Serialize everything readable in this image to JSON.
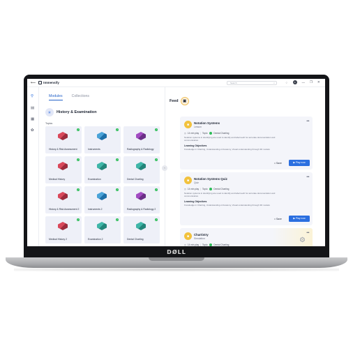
{
  "device": {
    "brand": "DØLL"
  },
  "topbar": {
    "back": "⟵",
    "app_name": "Immensify",
    "search_placeholder": "Search",
    "search_icon": "⌕",
    "bell_icon": "🔔",
    "avatar_letter": "A",
    "minimize": "—",
    "restore": "❐",
    "close": "✕"
  },
  "rail": {
    "icons": [
      "search-icon",
      "chart-icon",
      "library-icon",
      "brain-icon"
    ]
  },
  "left": {
    "tabs": [
      {
        "label": "Modules",
        "active": true
      },
      {
        "label": "Collections",
        "active": false
      }
    ],
    "subject": "History & Examination",
    "topics_label": "Topics",
    "topics": [
      {
        "label": "History & Risk Assessment",
        "tile": "a"
      },
      {
        "label": "Instruments",
        "tile": "b"
      },
      {
        "label": "Radiography & Radiology",
        "tile": "c"
      },
      {
        "label": "Medical History",
        "tile": "a"
      },
      {
        "label": "Examination",
        "tile": "d"
      },
      {
        "label": "Dental Charting",
        "tile": "d"
      },
      {
        "label": "History & Risk Assessment 2",
        "tile": "a"
      },
      {
        "label": "Instruments 2",
        "tile": "b"
      },
      {
        "label": "Radiography & Radiology 2",
        "tile": "c"
      },
      {
        "label": "Medical History 2",
        "tile": "a"
      },
      {
        "label": "Examination 2",
        "tile": "d"
      },
      {
        "label": "Dental Charting",
        "tile": "d"
      }
    ]
  },
  "feed": {
    "title": "Feed",
    "cards": [
      {
        "title": "Notation Systems",
        "type": "Lesson",
        "duration": "14 min play",
        "topic_prefix": "Topic:",
        "topic": "Dental Charting",
        "description": "Notation systems in identifying are used to identify and label teeth for accurate documentation and communication.",
        "objectives_label": "Learning Objectives",
        "objectives": "Knowledge in Charting, Understanding of Anatomy, Visual understanding through 3D models",
        "save": "Save",
        "play": "▶ Play now"
      },
      {
        "title": "Notation Systems Quiz",
        "type": "Quiz",
        "duration": "14 min play",
        "topic_prefix": "Topic:",
        "topic": "Dental Charting",
        "description": "Notation systems in identifying are used to identify and label teeth for accurate documentation and communication.",
        "objectives_label": "Learning Objectives",
        "objectives": "Knowledge in Charting, Understanding of Anatomy, Visual understanding through 3D models",
        "save": "Save",
        "play": "▶ Play now"
      },
      {
        "title": "Chartistry",
        "type": "Simulation",
        "duration": "14 min play",
        "topic_prefix": "Topic:",
        "topic": "Dental Charting"
      }
    ]
  }
}
